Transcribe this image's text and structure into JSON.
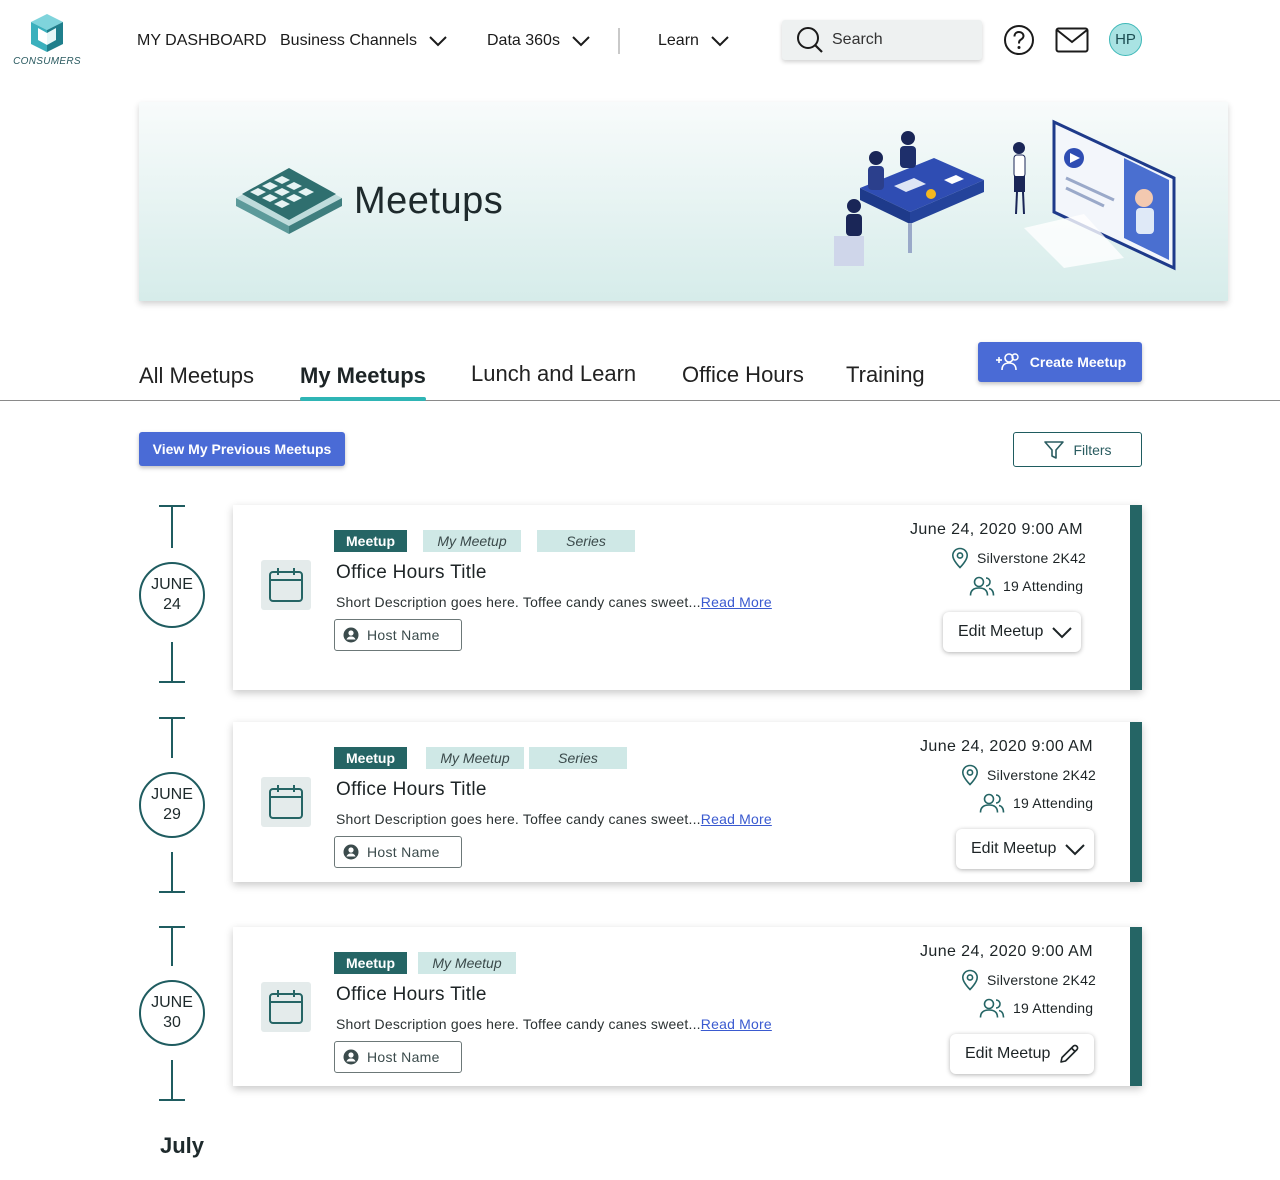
{
  "brand": {
    "logo_text": "CONSUMERS"
  },
  "nav": {
    "dashboard": "MY DASHBOARD",
    "business_channels": "Business Channels",
    "data360": "Data 360s",
    "learn": "Learn",
    "search_placeholder": "Search",
    "avatar_initials": "HP"
  },
  "hero": {
    "title": "Meetups"
  },
  "tabs": [
    {
      "label": "All Meetups",
      "active": false
    },
    {
      "label": "My Meetups",
      "active": true
    },
    {
      "label": "Lunch and Learn",
      "active": false
    },
    {
      "label": "Office Hours",
      "active": false
    },
    {
      "label": "Training",
      "active": false
    }
  ],
  "actions": {
    "create_meetup": "Create Meetup",
    "view_previous": "View My Previous Meetups",
    "filters": "Filters"
  },
  "timeline": [
    {
      "month": "JUNE",
      "day": "24"
    },
    {
      "month": "JUNE",
      "day": "29"
    },
    {
      "month": "JUNE",
      "day": "30"
    }
  ],
  "month_label": "July",
  "cards": [
    {
      "tags": [
        "Meetup",
        "My Meetup",
        "Series"
      ],
      "title": "Office Hours Title",
      "description": "Short Description goes here. Toffee candy canes sweet...",
      "read_more": "Read More",
      "host": "Host Name",
      "datetime": "June 24, 2020 9:00 AM",
      "location": "Silverstone 2K42",
      "attending": "19 Attending",
      "edit_label": "Edit Meetup",
      "edit_icon": "chevron-down-icon"
    },
    {
      "tags": [
        "Meetup",
        "My Meetup",
        "Series"
      ],
      "title": "Office Hours Title",
      "description": "Short Description goes here. Toffee candy canes sweet...",
      "read_more": "Read More",
      "host": "Host Name",
      "datetime": "June 24, 2020 9:00 AM",
      "location": "Silverstone 2K42",
      "attending": "19 Attending",
      "edit_label": "Edit Meetup",
      "edit_icon": "chevron-down-icon"
    },
    {
      "tags": [
        "Meetup",
        "My Meetup"
      ],
      "title": "Office Hours Title",
      "description": "Short Description goes here. Toffee candy canes sweet...",
      "read_more": "Read More",
      "host": "Host Name",
      "datetime": "June 24, 2020 9:00 AM",
      "location": "Silverstone 2K42",
      "attending": "19 Attending",
      "edit_label": "Edit Meetup",
      "edit_icon": "pencil-icon"
    }
  ],
  "colors": {
    "accent_teal": "#256565",
    "tab_underline": "#2fb5b5",
    "primary_button": "#4a6bd6",
    "tag_soft": "#cfe8e6"
  }
}
